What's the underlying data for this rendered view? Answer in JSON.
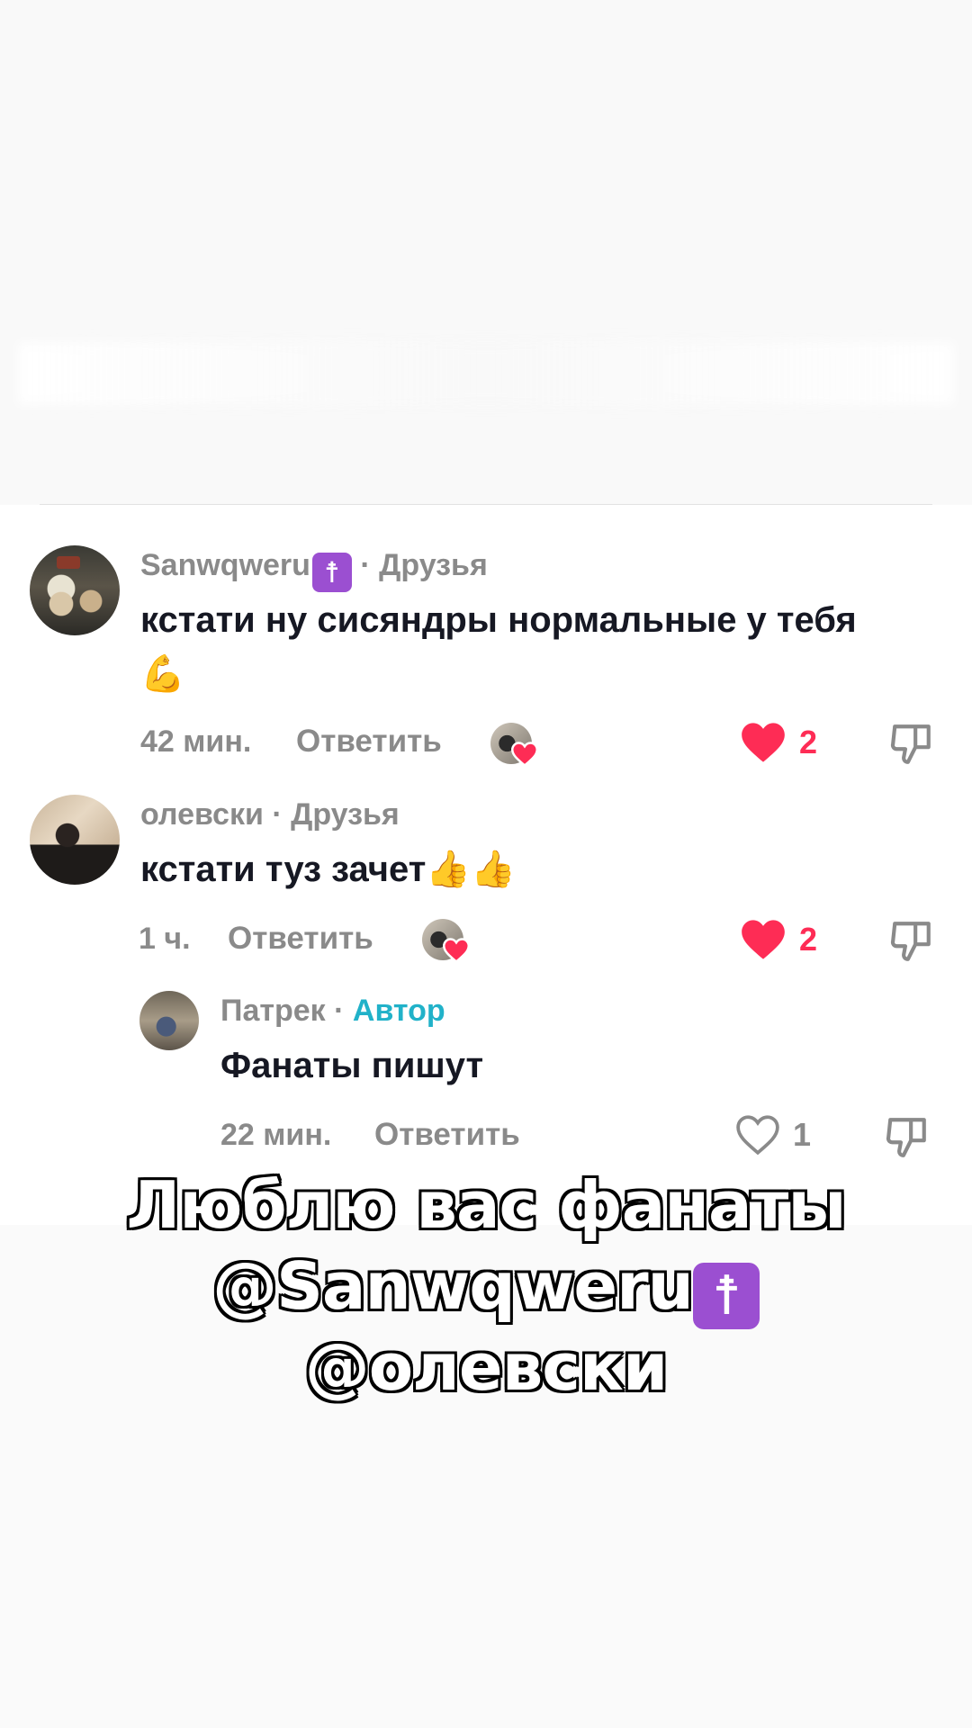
{
  "comments": [
    {
      "username": "Sanwqweru",
      "badge": "☨",
      "separator": " · ",
      "tag": "Друзья",
      "text": "кстати ну сисяндры нормальные у тебя",
      "emoji": "💪",
      "time": "42 мин.",
      "reply_label": "Ответить",
      "likes": "2",
      "liked": true
    },
    {
      "username": "олевски",
      "separator": " · ",
      "tag": "Друзья",
      "text": "кстати туз зачет",
      "emoji": "👍👍",
      "time": "1 ч.",
      "reply_label": "Ответить",
      "likes": "2",
      "liked": true
    },
    {
      "username": "Патрек",
      "separator": " · ",
      "tag": "Автор",
      "text": "Фанаты пишут",
      "time": "22 мин.",
      "reply_label": "Ответить",
      "likes": "1",
      "liked": false
    }
  ],
  "caption": {
    "line1": "Люблю вас фанаты",
    "line2_mention": "@Sanwqweru",
    "line2_badge": "☨",
    "line3": "@олевски"
  },
  "colors": {
    "like_red": "#fe2c55",
    "author_teal": "#21b2c9",
    "badge_purple": "#9b4fd1",
    "meta_grey": "#8a8a8a"
  },
  "icons": [
    "heart-filled-icon",
    "heart-outline-icon",
    "dislike-icon",
    "orthodox-cross-icon"
  ]
}
